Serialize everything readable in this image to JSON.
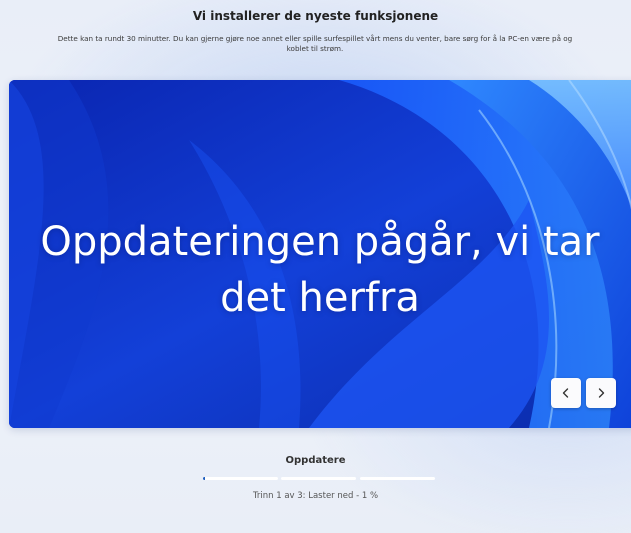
{
  "header": {
    "title": "Vi installerer de nyeste funksjonene",
    "subtitle": "Dette kan ta rundt 30 minutter. Du kan gjerne gjøre noe annet eller spille surfespillet vårt mens du venter, bare sørg for å la PC-en være på og koblet til strøm."
  },
  "slideshow": {
    "headline": "Oppdateringen pågår, vi tar det herfra",
    "prev_icon": "chevron-left-icon",
    "next_icon": "chevron-right-icon",
    "background_colors": [
      "#0a2fc4",
      "#1f6bff",
      "#6fb8ff"
    ]
  },
  "progress": {
    "label": "Oppdatere",
    "step_fractions": [
      0.01,
      0,
      0
    ],
    "status": "Trinn 1 av 3: Laster ned - 1 %",
    "accent_color": "#1f5fbf"
  }
}
